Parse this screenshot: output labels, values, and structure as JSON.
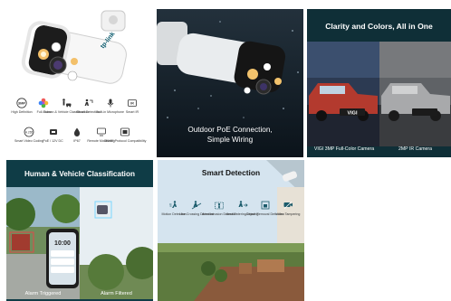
{
  "tile1": {
    "brand": "tp-link",
    "row1": [
      {
        "label": "High Definition",
        "icon": "hd-icon"
      },
      {
        "label": "Full-Color",
        "icon": "color-wheel-icon"
      },
      {
        "label": "Human & Vehicle Classification",
        "icon": "person-car-icon"
      },
      {
        "label": "Smart Detection",
        "icon": "smart-detect-icon"
      },
      {
        "label": "Built-in Microphone",
        "icon": "microphone-icon"
      },
      {
        "label": "Smart IR",
        "icon": "ir-icon"
      }
    ],
    "row2": [
      {
        "label": "Smart Video Coding",
        "icon": "video-coding-icon"
      },
      {
        "label": "PoE / 12V DC",
        "icon": "poe-icon"
      },
      {
        "label": "IP67",
        "icon": "waterproof-icon"
      },
      {
        "label": "Remote Monitoring",
        "icon": "monitor-icon"
      },
      {
        "label": "ONVIF Protocol Compatibility",
        "icon": "onvif-icon"
      }
    ]
  },
  "tile2": {
    "caption": "Outdoor PoE Connection,\nSimple Wiring"
  },
  "tile3": {
    "title": "Clarity and Colors, All in One",
    "left_label": "VIGI 3MP Full-Color Camera",
    "right_label": "2MP IR Camera",
    "plate": "VIGI"
  },
  "tile4": {
    "title": "Human & Vehicle Classification",
    "phone_time": "10:00",
    "left_label": "Alarm Triggered",
    "right_label": "Alarm Filtered"
  },
  "tile5": {
    "title": "Smart Detection",
    "icons": [
      {
        "label": "Motion Detection",
        "icon": "motion-icon"
      },
      {
        "label": "Line Crossing Detection",
        "icon": "line-cross-icon"
      },
      {
        "label": "Area Intrusion Detection",
        "icon": "intrusion-icon"
      },
      {
        "label": "Area Entering/Leaving",
        "icon": "entering-icon"
      },
      {
        "label": "Object Removal Detection",
        "icon": "object-removal-icon"
      },
      {
        "label": "Video Tampering",
        "icon": "tamper-icon"
      }
    ]
  }
}
